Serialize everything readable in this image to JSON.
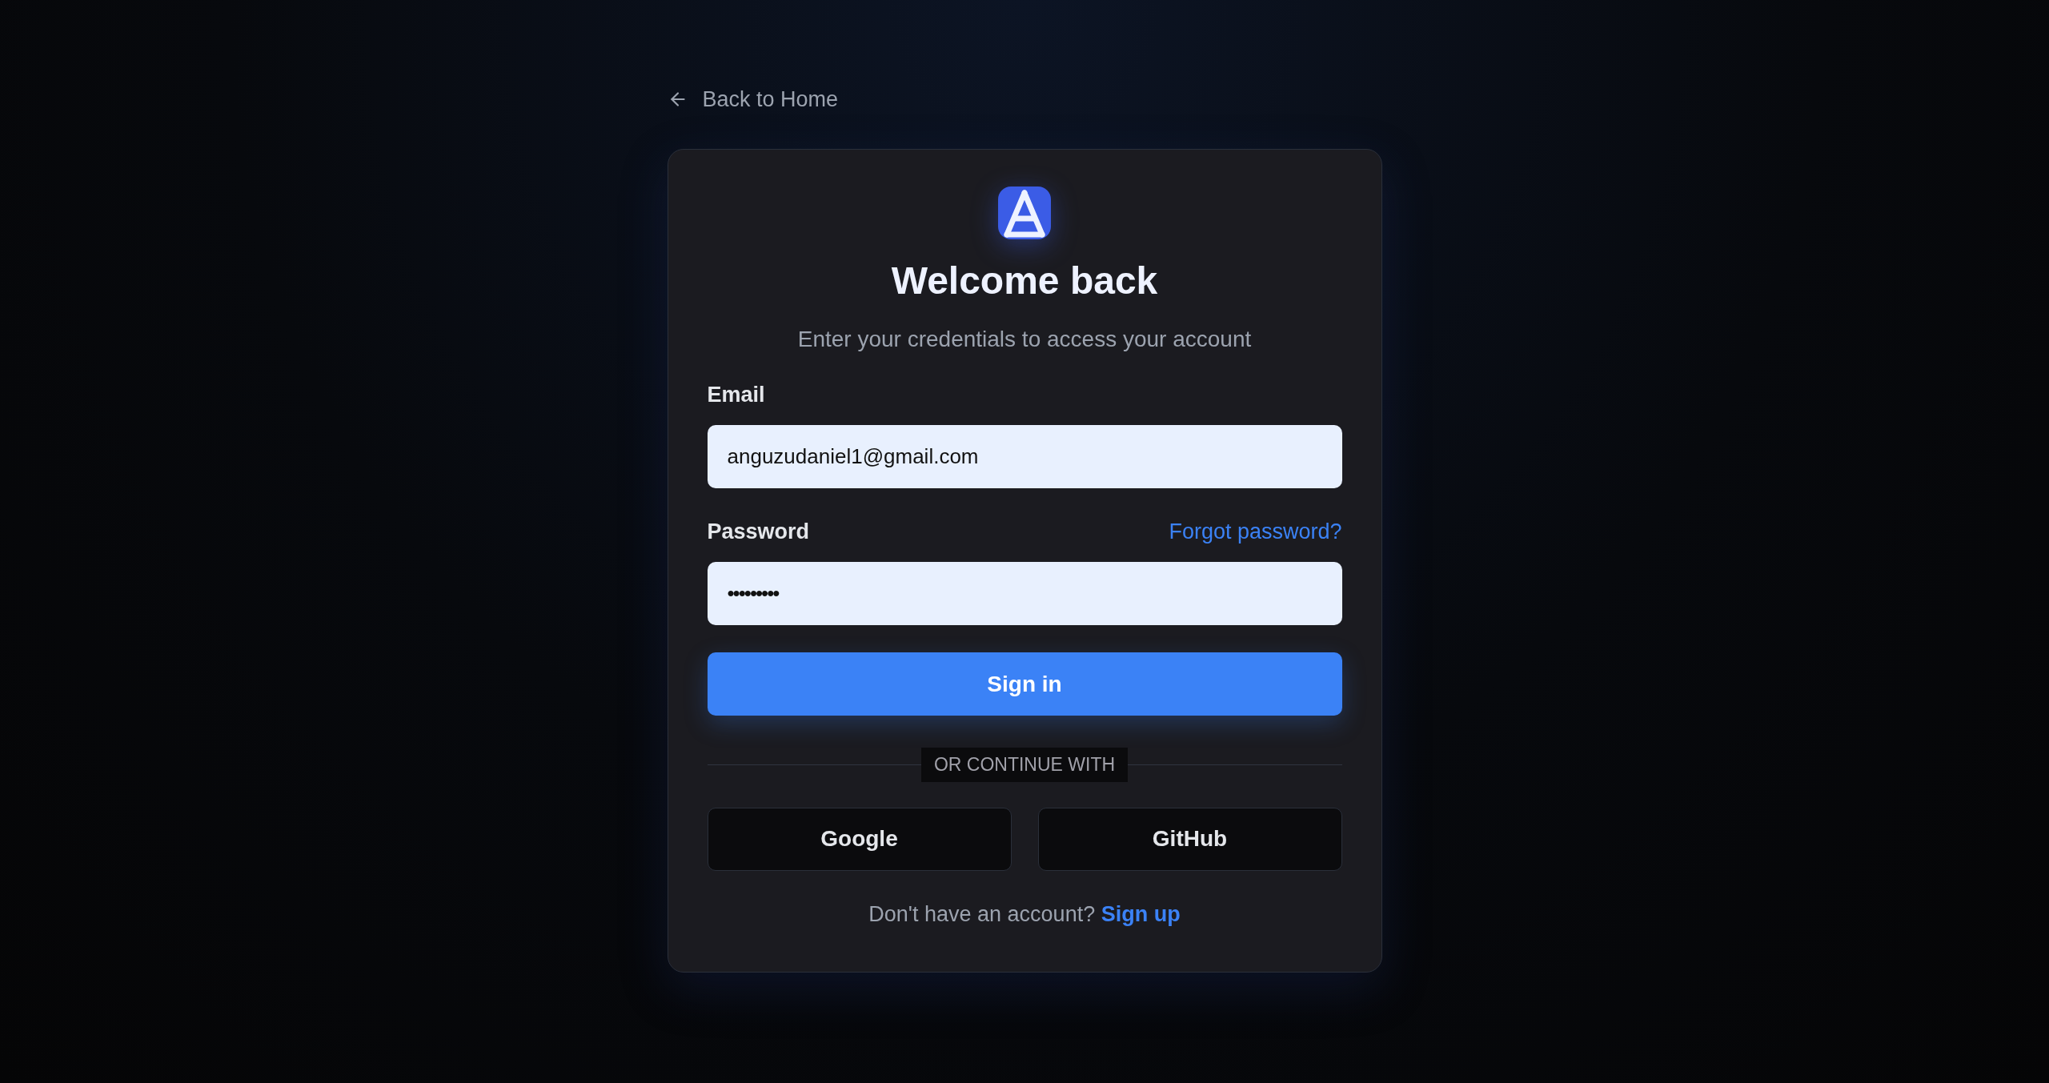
{
  "back_link": "Back to Home",
  "card": {
    "title": "Welcome back",
    "subtitle": "Enter your credentials to access your account"
  },
  "fields": [
    {
      "kind": "email",
      "label": "Email",
      "value": "anguzudaniel1@gmail.com"
    },
    {
      "kind": "password",
      "label": "Password",
      "value": "•••••••••",
      "link": "Forgot password?"
    }
  ],
  "submit": "Sign in",
  "divider": "OR CONTINUE WITH",
  "social_buttons": [
    "Google",
    "GitHub"
  ],
  "footer": {
    "text": "Don't have an account?",
    "link": "Sign up"
  }
}
